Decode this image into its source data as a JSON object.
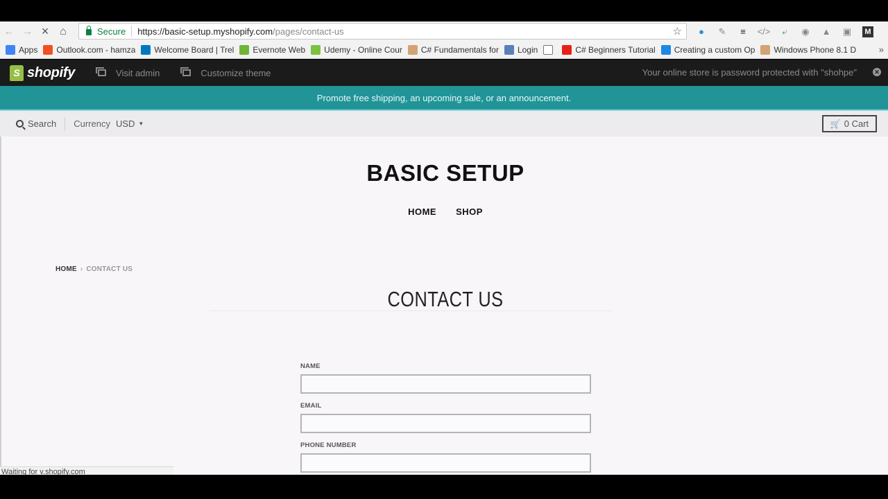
{
  "browser": {
    "secure_label": "Secure",
    "url_host": "https://basic-setup.myshopify.com",
    "url_path": "/pages/contact-us",
    "bookmarks": [
      {
        "label": "Apps",
        "icon": "apps-grid-icon",
        "color": "#4285f4"
      },
      {
        "label": "Outlook.com - hamza",
        "icon": "windows-logo-icon",
        "color": "#f25022"
      },
      {
        "label": "Welcome Board | Trel",
        "icon": "trello-icon",
        "color": "#0079bf"
      },
      {
        "label": "Evernote Web",
        "icon": "evernote-icon",
        "color": "#6fb536"
      },
      {
        "label": "Udemy - Online Cour",
        "icon": "udemy-icon",
        "color": "#7cc142"
      },
      {
        "label": "C# Fundamentals for",
        "icon": "pluralsight-icon",
        "color": "#d4a373"
      },
      {
        "label": "Login",
        "icon": "login-icon",
        "color": "#5b7fb8"
      },
      {
        "label": "",
        "icon": "blank-page-icon",
        "color": "#ffffff"
      },
      {
        "label": "C# Beginners Tutorial",
        "icon": "youtube-icon",
        "color": "#e62117"
      },
      {
        "label": "Creating a custom Op",
        "icon": "cart-bookmark-icon",
        "color": "#1e88e5"
      },
      {
        "label": "Windows Phone 8.1 D",
        "icon": "pluralsight-icon",
        "color": "#d4a373"
      }
    ],
    "more_label": "»",
    "status_text": "Waiting for v.shopify.com"
  },
  "admin_bar": {
    "logo_text": "shopify",
    "visit_admin": "Visit admin",
    "customize_theme": "Customize theme",
    "password_note": "Your online store is password protected with \"shohpe\""
  },
  "announcement": "Promote free shipping, an upcoming sale, or an announcement.",
  "utility_bar": {
    "search_label": "Search",
    "currency_label": "Currency",
    "currency_value": "USD",
    "cart_label": "0 Cart"
  },
  "store": {
    "title": "BASIC SETUP",
    "nav": [
      "HOME",
      "SHOP"
    ]
  },
  "breadcrumb": {
    "home": "HOME",
    "separator": "›",
    "current": "CONTACT US"
  },
  "page_heading": "CONTACT US",
  "form": {
    "fields": [
      {
        "label": "NAME",
        "value": ""
      },
      {
        "label": "EMAIL",
        "value": ""
      },
      {
        "label": "PHONE NUMBER",
        "value": ""
      }
    ]
  }
}
